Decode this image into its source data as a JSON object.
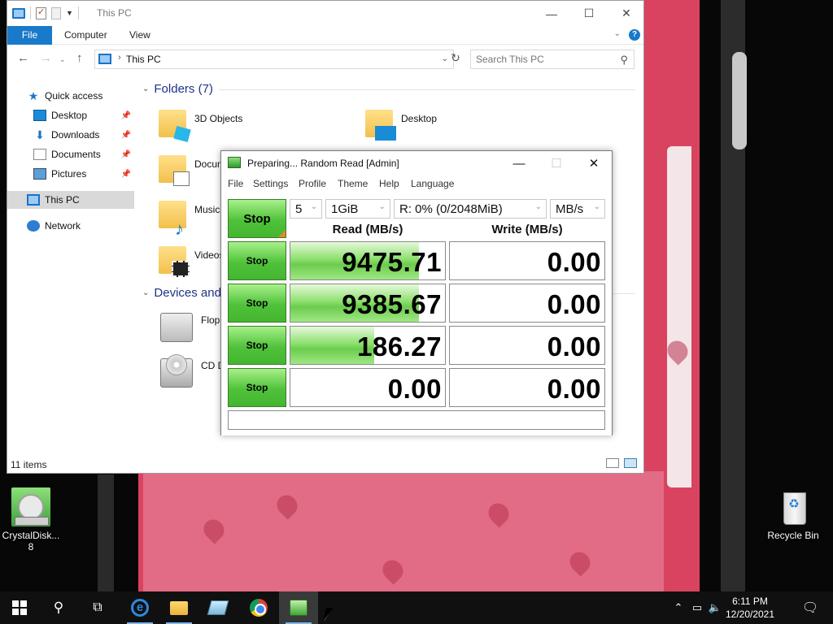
{
  "explorer": {
    "title": "This PC",
    "ribbon_tabs": [
      "File",
      "Computer",
      "View"
    ],
    "address_path": "This PC",
    "search_placeholder": "Search This PC",
    "nav": {
      "quick_access": "Quick access",
      "desktop": "Desktop",
      "downloads": "Downloads",
      "documents": "Documents",
      "pictures": "Pictures",
      "this_pc": "This PC",
      "network": "Network"
    },
    "folders_header": "Folders (7)",
    "folders": [
      "3D Objects",
      "Desktop",
      "Docum",
      "Music",
      "Videos"
    ],
    "devices_header": "Devices and",
    "devices": [
      "Floppy",
      "CD Dri"
    ],
    "status": "11 items"
  },
  "cdm": {
    "title": "Preparing... Random Read [Admin]",
    "menu": [
      "File",
      "Settings",
      "Profile",
      "Theme",
      "Help",
      "Language"
    ],
    "all_button": "Stop",
    "count": "5",
    "size": "1GiB",
    "drive": "R: 0% (0/2048MiB)",
    "unit": "MB/s",
    "read_header": "Read (MB/s)",
    "write_header": "Write (MB/s)",
    "rows": [
      {
        "button": "Stop",
        "read": "9475.71",
        "read_fill": 0.83,
        "write": "0.00",
        "write_fill": 0
      },
      {
        "button": "Stop",
        "read": "9385.67",
        "read_fill": 0.83,
        "write": "0.00",
        "write_fill": 0
      },
      {
        "button": "Stop",
        "read": "186.27",
        "read_fill": 0.54,
        "write": "0.00",
        "write_fill": 0
      },
      {
        "button": "Stop",
        "read": "0.00",
        "read_fill": 0,
        "write": "0.00",
        "write_fill": 0
      }
    ],
    "comment": ""
  },
  "desktop": {
    "crystaldisk_label": "CrystalDisk...\n8",
    "recycle_label": "Recycle Bin"
  },
  "taskbar": {
    "time": "6:11 PM",
    "date": "12/20/2021"
  }
}
